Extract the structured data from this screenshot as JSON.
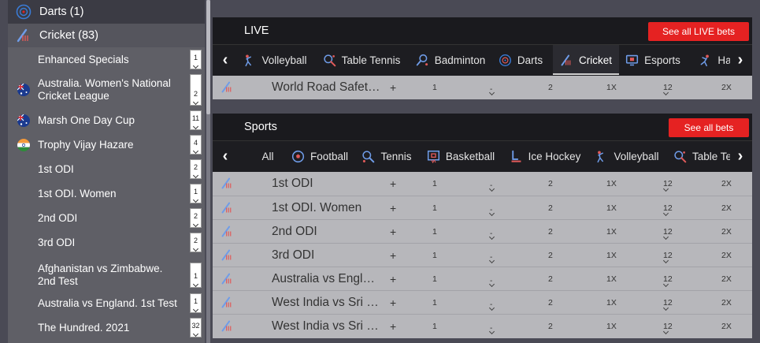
{
  "sidebar": {
    "categories": [
      {
        "label": "Darts (1)",
        "icon": "darts-icon"
      },
      {
        "label": "Cricket (83)",
        "icon": "cricket-icon"
      }
    ],
    "items": [
      {
        "label": "Enhanced Specials",
        "count": "1",
        "flag": ""
      },
      {
        "label": "Australia. Women's National Cricket League",
        "count": "2",
        "flag": "australia"
      },
      {
        "label": "Marsh One Day Cup",
        "count": "11",
        "flag": "australia"
      },
      {
        "label": "Trophy Vijay Hazare",
        "count": "4",
        "flag": "india"
      },
      {
        "label": "1st ODI",
        "count": "2",
        "flag": ""
      },
      {
        "label": "1st ODI. Women",
        "count": "1",
        "flag": ""
      },
      {
        "label": "2nd ODI",
        "count": "2",
        "flag": ""
      },
      {
        "label": "3rd ODI",
        "count": "2",
        "flag": ""
      },
      {
        "label": "Afghanistan vs Zimbabwe. 2nd Test",
        "count": "1",
        "flag": ""
      },
      {
        "label": "Australia vs England. 1st Test",
        "count": "1",
        "flag": ""
      },
      {
        "label": "The Hundred. 2021",
        "count": "32",
        "flag": ""
      }
    ]
  },
  "live": {
    "title": "LIVE",
    "see_all": "See all LIVE bets",
    "tabs": [
      {
        "label": "Volleyball",
        "icon": "volleyball-icon"
      },
      {
        "label": "Table Tennis",
        "icon": "table-tennis-icon"
      },
      {
        "label": "Badminton",
        "icon": "badminton-icon"
      },
      {
        "label": "Darts",
        "icon": "darts-icon"
      },
      {
        "label": "Cricket",
        "icon": "cricket-icon"
      },
      {
        "label": "Esports",
        "icon": "esports-icon"
      },
      {
        "label": "Ha",
        "icon": "handball-icon"
      }
    ],
    "rows": [
      {
        "name": "World Road Safet…",
        "plus": "+",
        "odds": [
          "1",
          "-",
          "2",
          "1X",
          "12",
          "2X"
        ]
      }
    ]
  },
  "sports": {
    "title": "Sports",
    "see_all": "See all bets",
    "tabs": [
      {
        "label": "All",
        "icon": ""
      },
      {
        "label": "Football",
        "icon": "football-icon"
      },
      {
        "label": "Tennis",
        "icon": "tennis-icon"
      },
      {
        "label": "Basketball",
        "icon": "basketball-icon"
      },
      {
        "label": "Ice Hockey",
        "icon": "ice-hockey-icon"
      },
      {
        "label": "Volleyball",
        "icon": "volleyball-icon"
      },
      {
        "label": "Table Te",
        "icon": "table-tennis-icon"
      }
    ],
    "rows": [
      {
        "name": "1st ODI",
        "plus": "+",
        "odds": [
          "1",
          "-",
          "2",
          "1X",
          "12",
          "2X"
        ]
      },
      {
        "name": "1st ODI. Women",
        "plus": "+",
        "odds": [
          "1",
          "-",
          "2",
          "1X",
          "12",
          "2X"
        ]
      },
      {
        "name": "2nd ODI",
        "plus": "+",
        "odds": [
          "1",
          "-",
          "2",
          "1X",
          "12",
          "2X"
        ]
      },
      {
        "name": "3rd ODI",
        "plus": "+",
        "odds": [
          "1",
          "-",
          "2",
          "1X",
          "12",
          "2X"
        ]
      },
      {
        "name": "Australia vs Engl…",
        "plus": "+",
        "odds": [
          "1",
          "-",
          "2",
          "1X",
          "12",
          "2X"
        ]
      },
      {
        "name": "West India vs Sri …",
        "plus": "+",
        "odds": [
          "1",
          "-",
          "2",
          "1X",
          "12",
          "2X"
        ]
      },
      {
        "name": "West India vs Sri …",
        "plus": "+",
        "odds": [
          "1",
          "-",
          "2",
          "1X",
          "12",
          "2X"
        ]
      }
    ]
  },
  "colors": {
    "accent": "#e52222",
    "panel": "#1d1d21",
    "row": "#b7b7bb",
    "sidebar": "#5f5f66"
  }
}
